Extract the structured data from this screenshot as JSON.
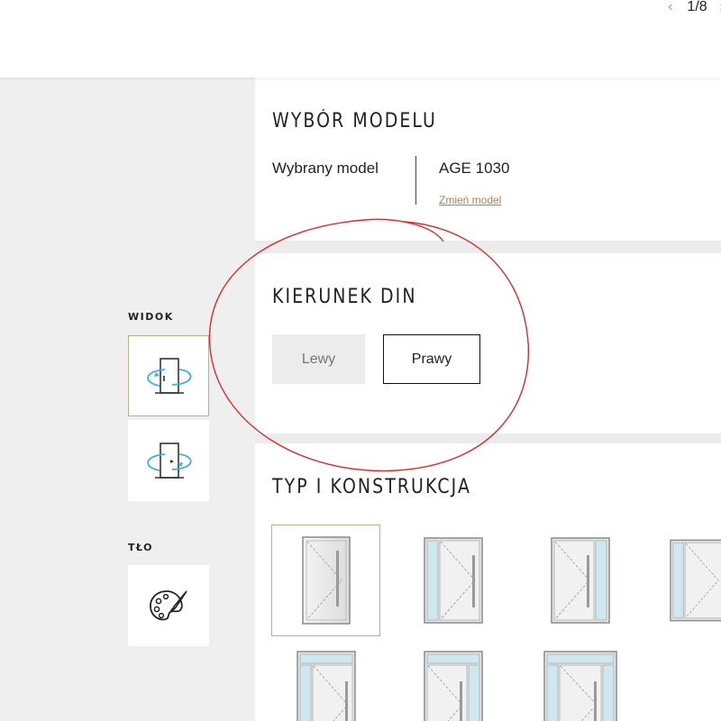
{
  "pager": {
    "current": "1/8",
    "prev_icon": "chevron-left-icon",
    "next_icon": "chevron-right-icon"
  },
  "sidebar": {
    "view_label": "WIDOK",
    "background_label": "TŁO",
    "view_buttons": [
      {
        "name": "view-inside-button",
        "icon": "door-rotate-inside-icon",
        "active": true
      },
      {
        "name": "view-outside-button",
        "icon": "door-rotate-outside-icon",
        "active": false
      }
    ],
    "background_button_icon": "palette-icon"
  },
  "model_section": {
    "title": "WYBÓR MODELU",
    "selected_label": "Wybrany model",
    "selected_value": "AGE 1030",
    "change_link": "Zmień model"
  },
  "din_section": {
    "title": "KIERUNEK DIN",
    "options": [
      {
        "label": "Lewy",
        "selected": false
      },
      {
        "label": "Prawy",
        "selected": true
      }
    ]
  },
  "type_section": {
    "title": "TYP I KONSTRUKCJA",
    "options": [
      {
        "icon": "door-single-icon",
        "selected": true
      },
      {
        "icon": "door-sidelight-left-icon",
        "selected": false
      },
      {
        "icon": "door-sidelight-right-icon",
        "selected": false
      },
      {
        "icon": "door-sidelights-both-icon",
        "selected": false
      },
      {
        "icon": "door-transom-sidelight-left-icon",
        "selected": false
      },
      {
        "icon": "door-transom-sidelight-right-icon",
        "selected": false
      },
      {
        "icon": "door-transom-sidelights-both-icon",
        "selected": false
      }
    ]
  },
  "colors": {
    "accent_border": "#c7ab82",
    "link": "#a5845a",
    "annotation": "#d92b2b",
    "panel_bg": "#ffffff",
    "page_bg": "#efefef"
  }
}
